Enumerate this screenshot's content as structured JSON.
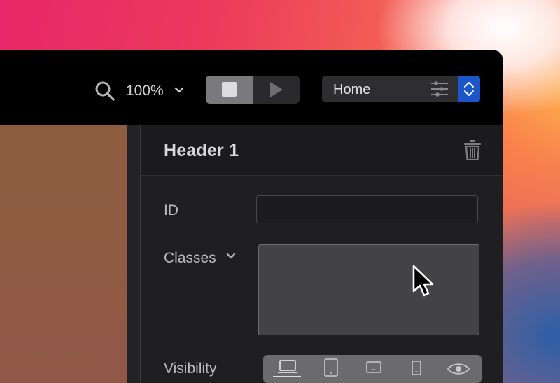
{
  "toolbar": {
    "zoom": {
      "value": "100%",
      "icon": "magnifier-icon"
    },
    "preview_toggle": {
      "stop_icon": "stop-icon",
      "play_icon": "play-icon",
      "active": "stop"
    },
    "page_selector": {
      "value": "Home",
      "filter_icon": "sliders-icon",
      "stepper_icon": "chevron-up-down-icon"
    }
  },
  "panel": {
    "title": "Header 1",
    "delete_icon": "trash-icon",
    "fields": {
      "id": {
        "label": "ID",
        "value": ""
      },
      "classes": {
        "label": "Classes",
        "value": ""
      },
      "visibility": {
        "label": "Visibility",
        "devices": [
          "laptop-icon",
          "tablet-icon",
          "tablet-landscape-icon",
          "phone-icon",
          "eye-icon"
        ],
        "selected": "laptop-icon"
      }
    }
  },
  "colors": {
    "accent": "#1d56c8",
    "panel_bg": "#1f1f21",
    "toolbar_bg": "#000000"
  }
}
